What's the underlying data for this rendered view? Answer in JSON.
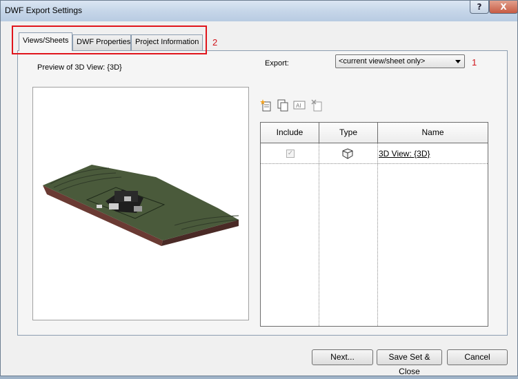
{
  "window": {
    "title": "DWF Export Settings",
    "help_glyph": "?",
    "close_glyph": "X"
  },
  "tabs": [
    {
      "label": "Views/Sheets",
      "active": true
    },
    {
      "label": "DWF Properties",
      "active": false
    },
    {
      "label": "Project Information",
      "active": false
    }
  ],
  "annotations": {
    "tabs_marker": "2",
    "export_marker": "1",
    "color": "#e0141b"
  },
  "preview": {
    "label": "Preview of 3D View: {3D}"
  },
  "export": {
    "label": "Export:",
    "selected": "<current view/sheet only>"
  },
  "toolbar": {
    "icons": [
      "new-set-icon",
      "duplicate-set-icon",
      "rename-set-icon",
      "delete-set-icon"
    ]
  },
  "table": {
    "columns": [
      "Include",
      "Type",
      "Name"
    ],
    "rows": [
      {
        "include": true,
        "type_icon": "3d-view-icon",
        "name": "3D View: {3D}"
      }
    ]
  },
  "buttons": {
    "next": "Next...",
    "save": "Save Set & Close",
    "cancel": "Cancel"
  }
}
